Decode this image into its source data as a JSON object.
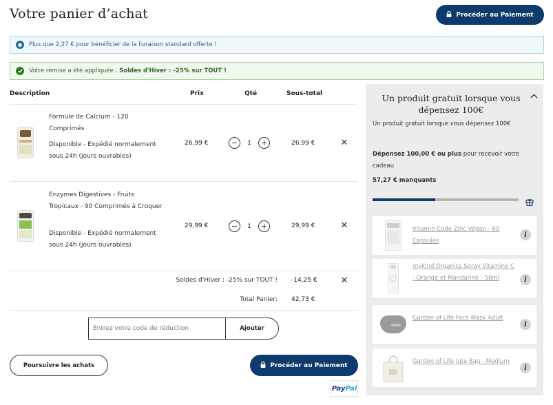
{
  "page": {
    "title": "Votre panier d’achat"
  },
  "header": {
    "checkout_label": "Procéder au Paiement"
  },
  "notices": {
    "shipping": "Plus que 2,27 € pour bénéficier de la livraison standard offerte !",
    "discount_prefix": "Votre remise a été appliquée : ",
    "discount_name": "Soldes d'Hiver : -25% sur TOUT !"
  },
  "table": {
    "headers": {
      "description": "Description",
      "price": "Prix",
      "qty": "Qté",
      "subtotal": "Sous-total"
    }
  },
  "items": [
    {
      "name": "Formule de Calcium - 120 Comprimés",
      "stock": "Disponible - Expédié normalement sous 24h (jours ouvrables)",
      "price": "26,99 €",
      "qty": "1",
      "subtotal": "26,99 €"
    },
    {
      "name": "Enzymes Digestives - Fruits Tropicaux - 90 Comprimés à Croquer",
      "stock": "Disponible - Expédié normalement sous 24h (jours ouvrables)",
      "price": "29,99 €",
      "qty": "1",
      "subtotal": "29,99 €"
    }
  ],
  "summary": {
    "discount_label": "Soldes d'Hiver : -25% sur TOUT !",
    "discount_value": "-14,25 €",
    "total_label": "Total Panier:",
    "total_value": "42,73 €"
  },
  "promo": {
    "placeholder": "Entrez votre code de réduction",
    "button": "Ajouter"
  },
  "footer": {
    "continue_label": "Poursuivre les achats",
    "checkout_label": "Procéder au Paiement",
    "paypal_a": "Pay",
    "paypal_b": "Pal"
  },
  "sidebar": {
    "title": "Un produit gratuit lorsque vous dépensez 100€",
    "subtitle": "Un produit gratuit lorsque vous dépensez 100€",
    "desc_bold": "Dépensez 100,00 € ou plus",
    "desc_rest": " pour recevoir votre cadeau",
    "missing": "57,27 € manquants",
    "progress_fraction": 0.43,
    "gifts": [
      {
        "name": "Vitamin Code Zinc Végan - 60 Capsules"
      },
      {
        "name": "mykind Organics Spray Vitamine C - Orange et Mandarine - 58ml"
      },
      {
        "name": "Garden of Life Face Mask Adult"
      },
      {
        "name": "Garden of Life Jute Bag - Medium"
      }
    ]
  },
  "colors": {
    "brand_navy": "#0d3b6e",
    "info_bg": "#f0f8fb",
    "success_bg": "#f1f8ef",
    "sidebar_bg": "#ececec"
  },
  "icons": [
    "lock-icon",
    "info-icon",
    "check-circle-icon",
    "minus-icon",
    "plus-icon",
    "close-icon",
    "chevron-up-icon",
    "gift-icon",
    "paypal-logo"
  ]
}
